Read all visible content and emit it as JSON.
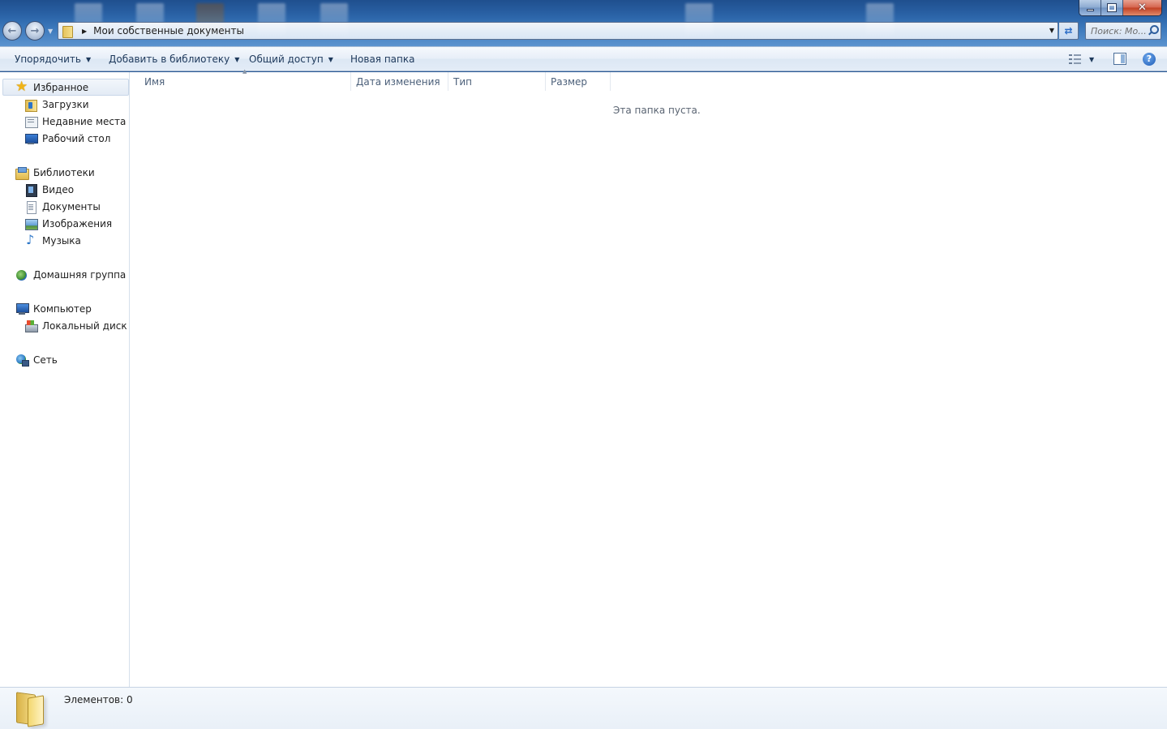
{
  "address": {
    "path_label": "Мои собственные документы"
  },
  "search": {
    "placeholder": "Поиск: Мо..."
  },
  "toolbar": {
    "organize_label": "Упорядочить",
    "add_to_library_label": "Добавить в библиотеку",
    "share_label": "Общий доступ",
    "new_folder_label": "Новая папка",
    "help_glyph": "?"
  },
  "nav": {
    "favorites": {
      "title": "Избранное",
      "items": [
        "Загрузки",
        "Недавние места",
        "Рабочий стол"
      ]
    },
    "libraries": {
      "title": "Библиотеки",
      "items": [
        "Видео",
        "Документы",
        "Изображения",
        "Музыка"
      ]
    },
    "homegroup": {
      "title": "Домашняя группа"
    },
    "computer": {
      "title": "Компьютер",
      "items": [
        "Локальный диск (C:"
      ]
    },
    "network": {
      "title": "Сеть"
    }
  },
  "columns": [
    "Имя",
    "Дата изменения",
    "Тип",
    "Размер"
  ],
  "content": {
    "empty_message": "Эта папка пуста."
  },
  "status": {
    "item_count": "Элементов: 0"
  },
  "colors": {
    "accent": "#1e395b",
    "glass": "#2b64a8",
    "pane_background": "#ffffff"
  }
}
